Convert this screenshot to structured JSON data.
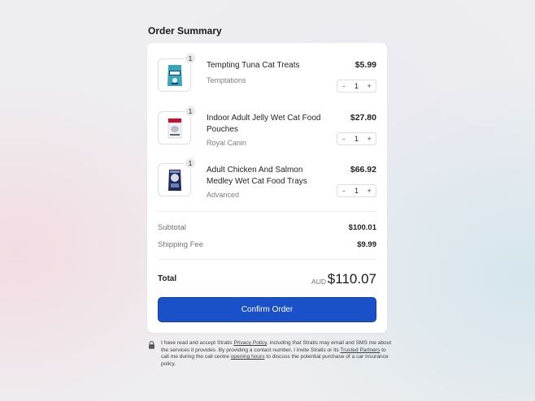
{
  "page": {
    "title": "Order Summary"
  },
  "items": [
    {
      "name": "Tempting Tuna Cat Treats",
      "brand": "Temptations",
      "price": "$5.99",
      "quantity": "1",
      "icon": "cat-treats-pouch-icon"
    },
    {
      "name": "Indoor Adult Jelly Wet Cat Food Pouches",
      "brand": "Royal Canin",
      "price": "$27.80",
      "quantity": "1",
      "icon": "cat-food-pouch-icon"
    },
    {
      "name": "Adult Chicken And Salmon Medley Wet Cat Food Trays",
      "brand": "Advanced",
      "price": "$66.92",
      "quantity": "1",
      "icon": "cat-food-bag-icon"
    }
  ],
  "stepper": {
    "minus": "-",
    "plus": "+"
  },
  "summary": {
    "subtotal_label": "Subtotal",
    "subtotal_value": "$100.01",
    "shipping_label": "Shipping Fee",
    "shipping_value": "$9.99",
    "total_label": "Total",
    "currency": "AUD",
    "total_value": "$110.07"
  },
  "confirm_button": "Confirm Order",
  "notice": {
    "icon": "lock-icon",
    "t1": "I have read and accept Stratis ",
    "privacy_link": "Privacy Policy",
    "t2": ", including that Stratis may email and SMS me about the services it provides. By providing a contact number, I invite Stratis or its ",
    "partners_link": "Trusted Partners",
    "t3": " to call me during the call centre ",
    "hours_link": "opening hours",
    "t4": " to discuss the potential purchase of a car insurance policy."
  },
  "colors": {
    "accent": "#1a50c8",
    "background": "#eeeef0",
    "card": "#ffffff"
  }
}
